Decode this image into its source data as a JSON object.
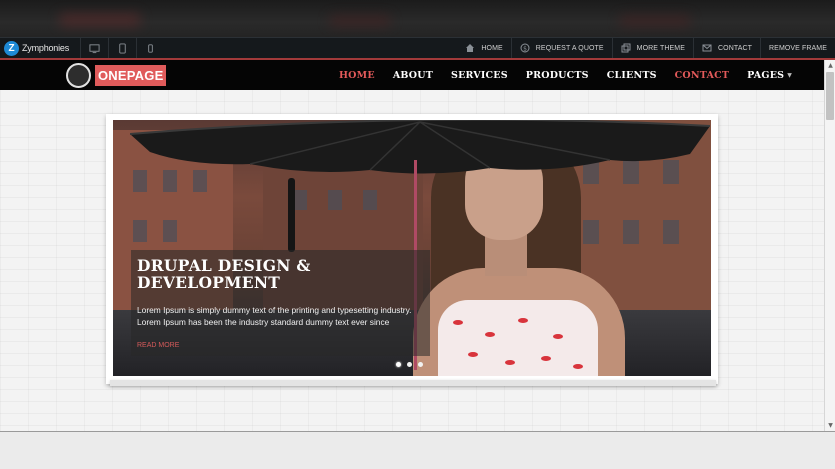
{
  "brand": {
    "logo_letter": "Z",
    "name": "Zymphonies"
  },
  "frame_nav": {
    "links": [
      {
        "label": "HOME",
        "icon": "home-icon"
      },
      {
        "label": "REQUEST A QUOTE",
        "icon": "quote-icon"
      },
      {
        "label": "MORE THEME",
        "icon": "copy-icon"
      },
      {
        "label": "CONTACT",
        "icon": "envelope-icon"
      },
      {
        "label": "REMOVE FRAME",
        "icon": ""
      }
    ],
    "devices": [
      "desktop-icon",
      "tablet-icon",
      "mobile-icon"
    ]
  },
  "site": {
    "logo_text": "ONEPAGE",
    "menu": [
      {
        "label": "HOME",
        "active": true
      },
      {
        "label": "ABOUT",
        "active": false
      },
      {
        "label": "SERVICES",
        "active": false
      },
      {
        "label": "PRODUCTS",
        "active": false
      },
      {
        "label": "CLIENTS",
        "active": false
      },
      {
        "label": "CONTACT",
        "active": true
      },
      {
        "label": "PAGES",
        "active": false
      }
    ]
  },
  "slider": {
    "title_line1": "DRUPAL DESIGN &",
    "title_line2": "DEVELOPMENT",
    "text_line1": "Lorem Ipsum is simply dummy text of the printing and typesetting industry.",
    "text_line2": "Lorem Ipsum has been the industry standard dummy text ever since",
    "read_more": "READ MORE",
    "slide_count": 3,
    "active_slide": 1
  },
  "colors": {
    "accent": "#e25a5a",
    "frame_bar": "#15191c",
    "nav_bg": "#050505"
  }
}
